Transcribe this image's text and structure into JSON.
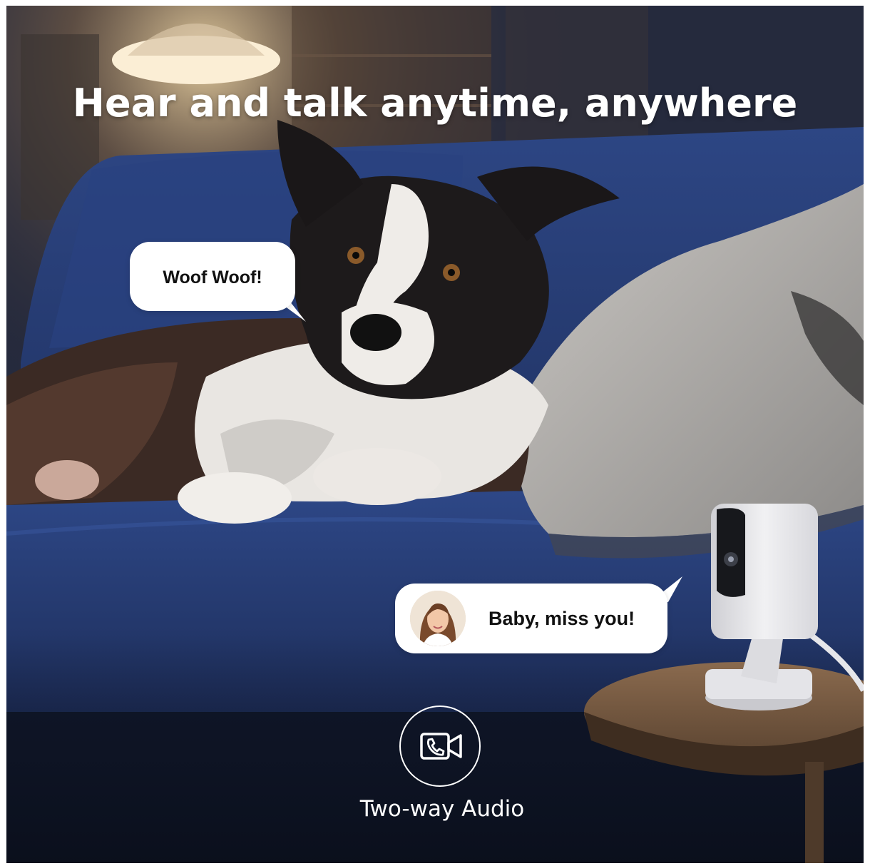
{
  "headline": "Hear and talk anytime, anywhere",
  "dog_bubble": {
    "text": "Woof Woof!"
  },
  "owner_bubble": {
    "text": "Baby, miss you!",
    "avatar_icon": "woman-avatar-photo"
  },
  "feature": {
    "icon": "video-call-phone-icon",
    "label": "Two-way Audio"
  },
  "colors": {
    "sofa": "#24386b",
    "background": "#1a2238",
    "bubble": "#ffffff",
    "text_on_image": "#ffffff",
    "camera_body": "#e9e9ec"
  }
}
